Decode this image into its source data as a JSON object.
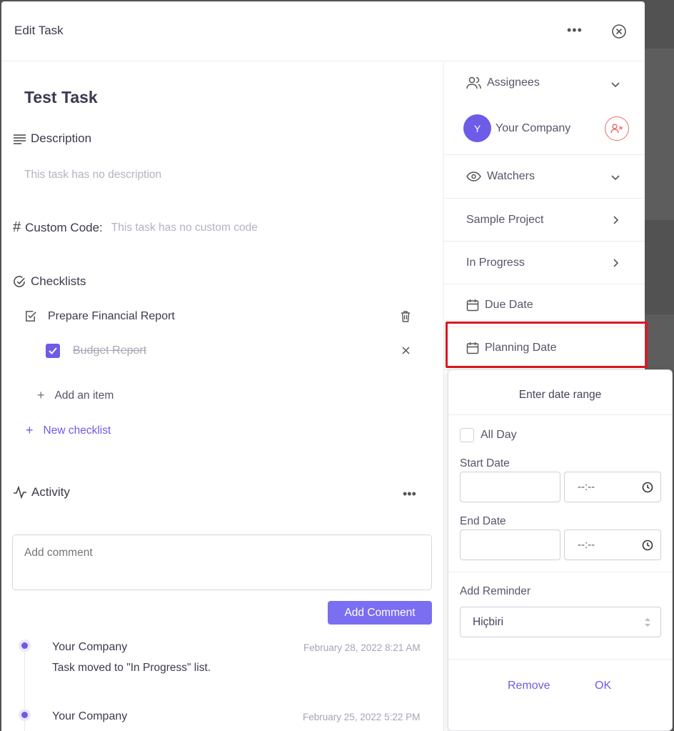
{
  "modal": {
    "title": "Edit Task"
  },
  "task": {
    "title": "Test Task"
  },
  "description": {
    "heading": "Description",
    "empty_text": "This task has no description"
  },
  "custom_code": {
    "heading": "Custom Code:",
    "empty_text": "This task has no custom code"
  },
  "checklists": {
    "heading": "Checklists",
    "list_name": "Prepare Financial Report",
    "items": [
      {
        "label": "Budget Report",
        "checked": true
      }
    ],
    "add_item_label": "Add an item",
    "new_checklist_label": "New checklist"
  },
  "activity": {
    "heading": "Activity",
    "comment_placeholder": "Add comment",
    "add_comment_label": "Add Comment",
    "entries": [
      {
        "user": "Your Company",
        "time": "February 28, 2022 8:21 AM",
        "text": "Task moved to \"In Progress\" list."
      },
      {
        "user": "Your Company",
        "time": "February 25, 2022 5:22 PM",
        "text": ""
      }
    ]
  },
  "sidebar": {
    "assignees_label": "Assignees",
    "assignee": {
      "initial": "Y",
      "name": "Your Company"
    },
    "watchers_label": "Watchers",
    "project_label": "Sample Project",
    "status_label": "In Progress",
    "due_date_label": "Due Date",
    "planning_date_label": "Planning Date"
  },
  "date_popup": {
    "title": "Enter date range",
    "all_day_label": "All Day",
    "start_date_label": "Start Date",
    "end_date_label": "End Date",
    "time_placeholder": "--:--",
    "reminder_label": "Add Reminder",
    "reminder_value": "Hiçbiri",
    "remove_label": "Remove",
    "ok_label": "OK"
  },
  "colors": {
    "accent": "#6c5ce7",
    "highlight": "#e0161f",
    "danger": "#ef6a6a"
  }
}
